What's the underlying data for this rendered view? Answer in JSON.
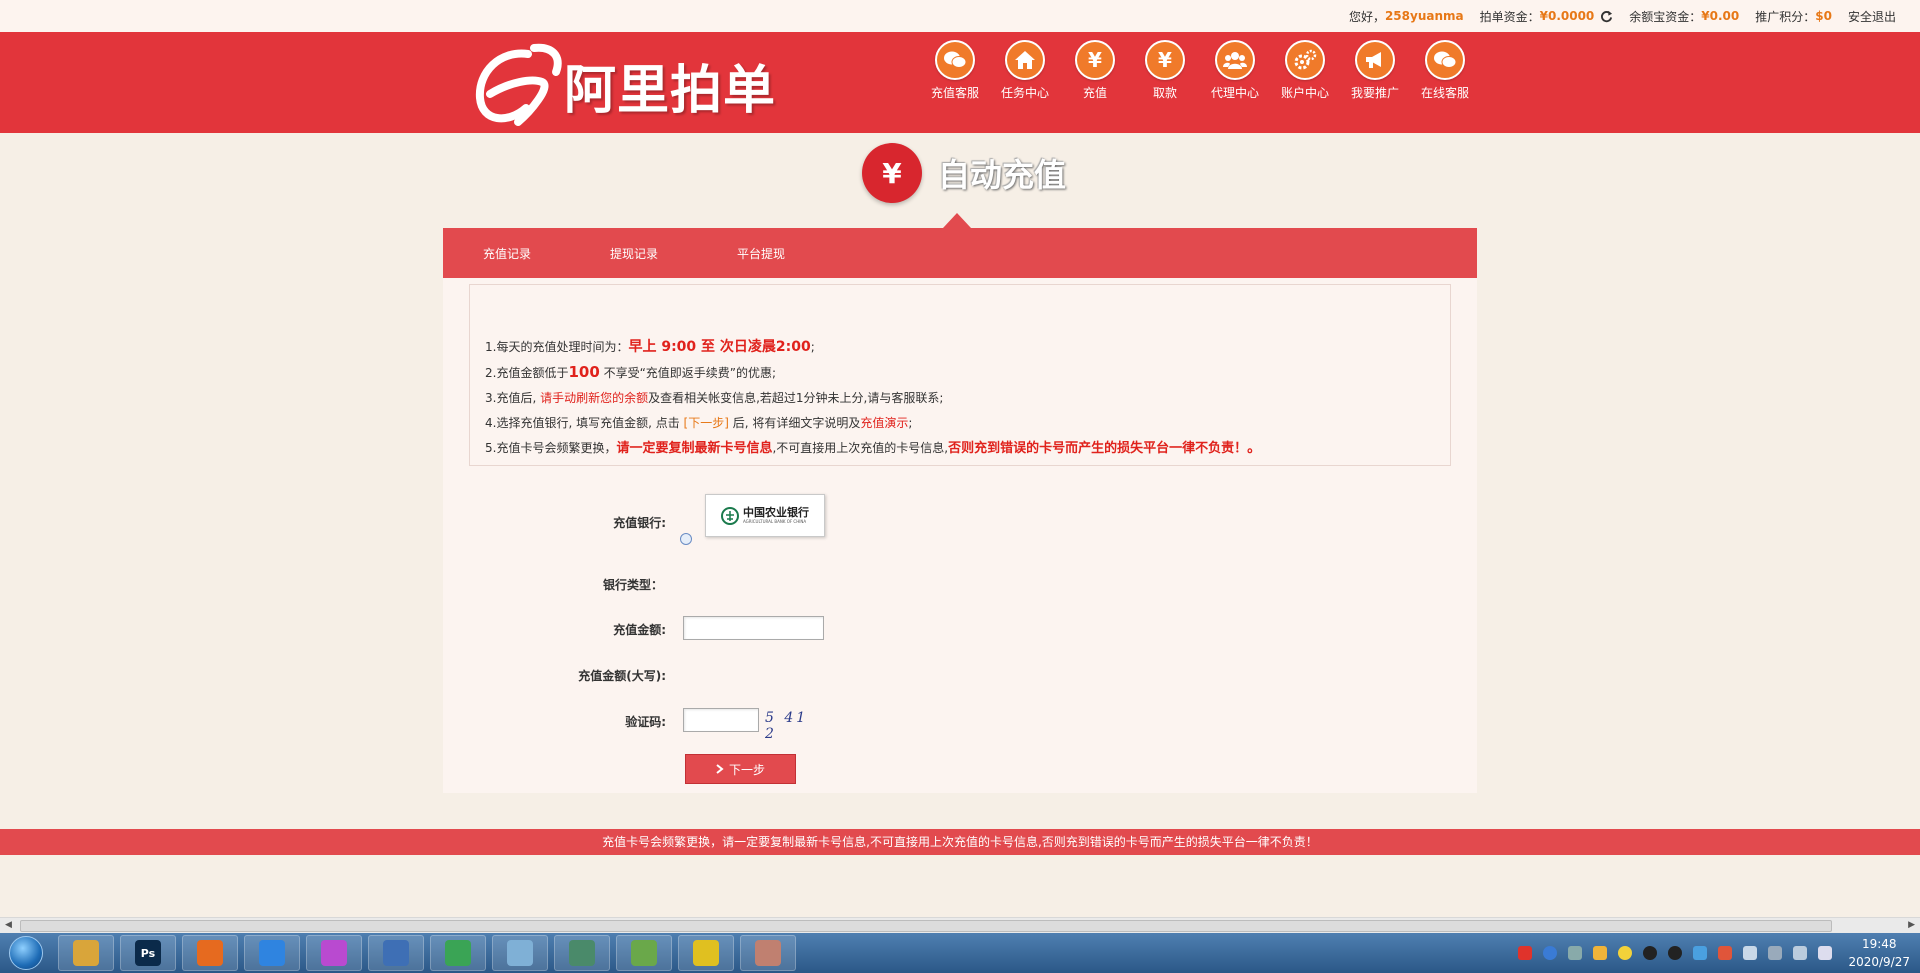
{
  "topbar": {
    "greeting": "您好，",
    "username": "258yuanma",
    "funds_label": "拍单资金：",
    "funds_value": "¥0.0000",
    "yuebao_label": "余额宝资金：",
    "yuebao_value": "¥0.00",
    "points_label": "推广积分：",
    "points_value": "$0",
    "logout": "安全退出"
  },
  "header": {
    "logo_text": "阿里拍单",
    "nav": [
      {
        "label": "充值客服",
        "icon": "wechat-icon"
      },
      {
        "label": "任务中心",
        "icon": "home-icon"
      },
      {
        "label": "充值",
        "icon": "yen-icon"
      },
      {
        "label": "取款",
        "icon": "yen-icon"
      },
      {
        "label": "代理中心",
        "icon": "users-icon"
      },
      {
        "label": "账户中心",
        "icon": "gears-icon"
      },
      {
        "label": "我要推广",
        "icon": "megaphone-icon"
      },
      {
        "label": "在线客服",
        "icon": "wechat-icon"
      }
    ]
  },
  "section": {
    "icon": "¥",
    "title": "自动充值"
  },
  "tabs": [
    "充值记录",
    "提现记录",
    "平台提现"
  ],
  "notice": {
    "line1_a": "1.每天的充值处理时间为：",
    "line1_b": "早上 9:00 至 次日凌晨2:00",
    "line1_c": ";",
    "line2_a": "2.充值金额低于",
    "line2_b": "100",
    "line2_c": " 不享受“充值即返手续费”的优惠;",
    "line3_a": "3.充值后, ",
    "line3_b": "请手动刷新您的余额",
    "line3_c": "及查看相关帐变信息,若超过1分钟未上分,请与客服联系;",
    "line4_a": "4.选择充值银行, 填写充值金额, 点击 ",
    "line4_b": "[下一步]",
    "line4_c": " 后, 将有详细文字说明及",
    "line4_d": "充值演示",
    "line4_e": ";",
    "line5_a": "5.充值卡号会频繁更换，",
    "line5_b": "请一定要复制最新卡号信息",
    "line5_c": ",不可直接用上次充值的卡号信息,",
    "line5_d": "否则充到错误的卡号而产生的损失平台一律不负责！",
    "line5_e": "。"
  },
  "form": {
    "bank_label": "充值银行:",
    "bank_name": "中国农业银行",
    "bank_name_en": "AGRICULTURAL BANK OF CHINA",
    "bank_type_label": "银行类型：",
    "amount_label": "充值金额:",
    "amount_value": "",
    "amount_upper_label": "充值金额(大写):",
    "captcha_label": "验证码:",
    "captcha_value": "",
    "captcha_image_text": "5 41 2",
    "next_button": "下一步"
  },
  "footer": {
    "text": "充值卡号会频繁更换，请一定要复制最新卡号信息,不可直接用上次充值的卡号信息,否则充到错误的卡号而产生的损失平台一律不负责！"
  },
  "taskbar": {
    "apps": [
      {
        "name": "file-explorer-icon",
        "color": "#d9a53a",
        "label": ""
      },
      {
        "name": "photoshop-icon",
        "color": "#0b2a4a",
        "label": "Ps"
      },
      {
        "name": "firefox-icon",
        "color": "#e66a1f",
        "label": ""
      },
      {
        "name": "baidu-netdisk-icon",
        "color": "#2f84e0",
        "label": ""
      },
      {
        "name": "color-app-icon",
        "color": "#b94ad0",
        "label": ""
      },
      {
        "name": "network-tool-icon",
        "color": "#3e6fb5",
        "label": ""
      },
      {
        "name": "chrome-icon",
        "color": "#3aa455",
        "label": ""
      },
      {
        "name": "notepad-icon",
        "color": "#7fb0d6",
        "label": ""
      },
      {
        "name": "game-app-icon",
        "color": "#4a8a6a",
        "label": ""
      },
      {
        "name": "editor-app-icon",
        "color": "#6aa84a",
        "label": ""
      },
      {
        "name": "music-app-icon",
        "color": "#e0c020",
        "label": ""
      },
      {
        "name": "avatar-app-icon",
        "color": "#c08070",
        "label": ""
      }
    ],
    "time": "19:48",
    "date": "2020/9/27"
  }
}
